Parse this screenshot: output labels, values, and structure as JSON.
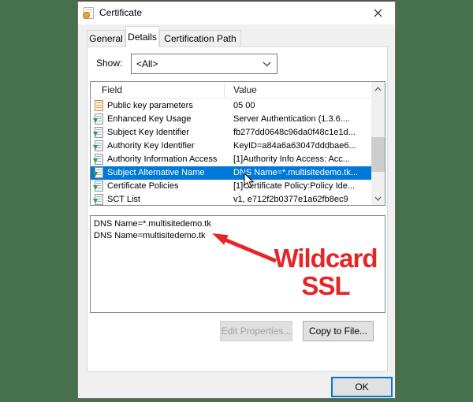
{
  "colors": {
    "backdrop_green": "#47704d",
    "selection_blue": "#0078d7",
    "annotation_red": "#e62528",
    "ok_focus_blue": "#0078d7"
  },
  "window": {
    "title": "Certificate"
  },
  "tabs": {
    "general": "General",
    "details": "Details",
    "certification_path": "Certification Path",
    "active": "Details"
  },
  "show": {
    "label": "Show:",
    "value": "<All>"
  },
  "list": {
    "col_field": "Field",
    "col_value": "Value",
    "rows": [
      {
        "field": "Public key parameters",
        "value": "05 00"
      },
      {
        "field": "Enhanced Key Usage",
        "value": "Server Authentication (1.3.6...."
      },
      {
        "field": "Subject Key Identifier",
        "value": "fb277dd0648c96da0f48c1e1d..."
      },
      {
        "field": "Authority Key Identifier",
        "value": "KeyID=a84a6a63047dddbae6..."
      },
      {
        "field": "Authority Information Access",
        "value": "[1]Authority Info Access: Acc..."
      },
      {
        "field": "Subject Alternative Name",
        "value": "DNS Name=*.multisitedemo.tk...",
        "selected": true
      },
      {
        "field": "Certificate Policies",
        "value": "[1]Certificate Policy:Policy Ide..."
      },
      {
        "field": "SCT List",
        "value": "v1, e712f2b0377e1a62fb8ec9"
      }
    ]
  },
  "details_panel": {
    "line1": "DNS Name=*.multisitedemo.tk",
    "line2": "DNS Name=multisitedemo.tk"
  },
  "annotation": {
    "line1": "Wildcard",
    "line2": "SSL"
  },
  "buttons": {
    "edit_properties": "Edit Properties...",
    "copy_to_file": "Copy to File...",
    "ok": "OK"
  },
  "icons": {
    "titlebar": "certificate-icon",
    "close": "close-icon",
    "combo_arrow": "chevron-down-icon",
    "scroll_up": "chevron-up-icon",
    "scroll_down": "chevron-down-icon",
    "plain_field": "document-icon",
    "extension_field": "extension-icon",
    "pointer": "mouse-cursor-icon",
    "callout": "red-arrow-annotation"
  }
}
